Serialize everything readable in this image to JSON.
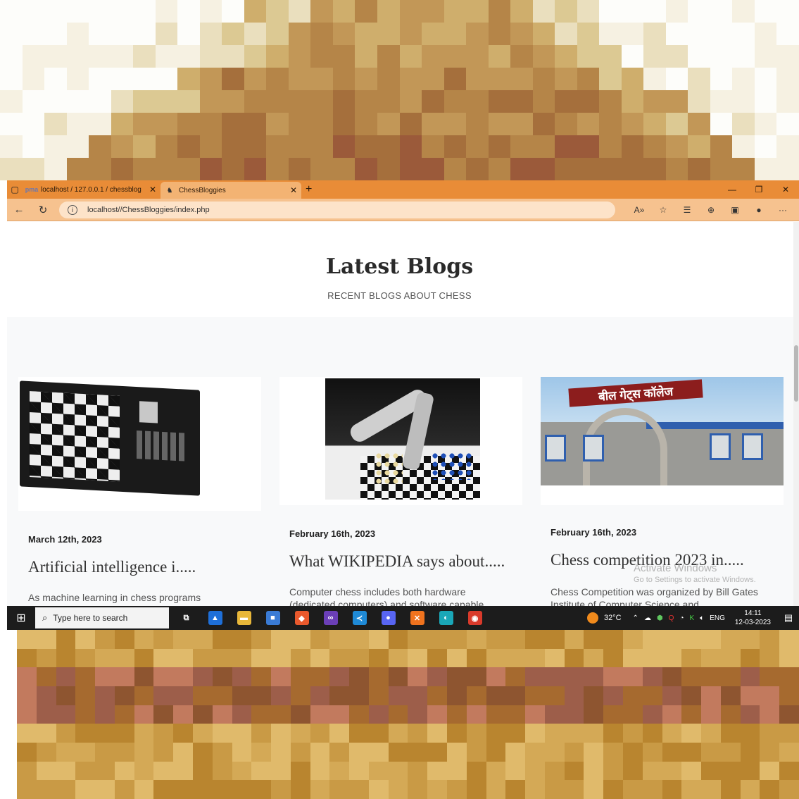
{
  "pixelated": {
    "top_palette": [
      "#fdfdfa",
      "#f6f1e2",
      "#eadfbe",
      "#dcc993",
      "#cfae6c",
      "#c29757",
      "#b58548",
      "#a56f3c",
      "#9b5a3a"
    ],
    "bottom_palette": [
      "#c99a45",
      "#d4a956",
      "#e0ba6b",
      "#b9852f",
      "#a66a2f",
      "#8e5530",
      "#9d5e4a",
      "#c27a5e",
      "#e6c27a"
    ]
  },
  "browser": {
    "tabs": [
      {
        "label": "localhost / 127.0.0.1 / chessblog",
        "favicon": "pma-icon",
        "active": false
      },
      {
        "label": "ChessBloggies",
        "favicon": "chess-icon",
        "active": true
      }
    ],
    "url": "localhost//ChessBloggies/index.php",
    "accent_color": "#e98c37"
  },
  "page": {
    "title": "Latest Blogs",
    "subtitle": "RECENT BLOGS ABOUT CHESS",
    "cards": [
      {
        "date": "March 12th, 2023",
        "title": "Artificial intelligence i.....",
        "excerpt": "As machine learning in chess programs"
      },
      {
        "date": "February 16th, 2023",
        "title": "What WIKIPEDIA says about.....",
        "excerpt": "Computer chess includes both hardware (dedicated computers) and software capable"
      },
      {
        "date": "February 16th, 2023",
        "title": "Chess competition 2023 in.....",
        "excerpt": "Chess Competition was organized by Bill Gates Institute of Computer Science and",
        "image_text": "बील गेट्स कॉलेज"
      }
    ]
  },
  "watermark": {
    "line1": "Activate Windows",
    "line2": "Go to Settings to activate Windows."
  },
  "taskbar": {
    "search_placeholder": "Type here to search",
    "apps": [
      {
        "name": "task-view-icon",
        "glyph": "⧉",
        "color": "#1c1c1c"
      },
      {
        "name": "azure-data-studio-icon",
        "glyph": "▲",
        "color": "#1e6fd8"
      },
      {
        "name": "file-explorer-icon",
        "glyph": "▬",
        "color": "#e8b73a"
      },
      {
        "name": "microsoft-store-icon",
        "glyph": "■",
        "color": "#3a7bd5"
      },
      {
        "name": "brave-icon",
        "glyph": "◆",
        "color": "#e9592d"
      },
      {
        "name": "visual-studio-icon",
        "glyph": "∞",
        "color": "#6b3fb7"
      },
      {
        "name": "vscode-icon",
        "glyph": "≺",
        "color": "#1f8ad6"
      },
      {
        "name": "discord-icon",
        "glyph": "●",
        "color": "#5865f2"
      },
      {
        "name": "xampp-icon",
        "glyph": "✕",
        "color": "#f0731e"
      },
      {
        "name": "edge-icon",
        "glyph": "◐",
        "color": "#1aa7b8"
      },
      {
        "name": "chrome-icon",
        "glyph": "◉",
        "color": "#d93a2b"
      }
    ],
    "weather": "32°C",
    "lang": "ENG",
    "time": "14:11",
    "date": "12-03-2023"
  }
}
